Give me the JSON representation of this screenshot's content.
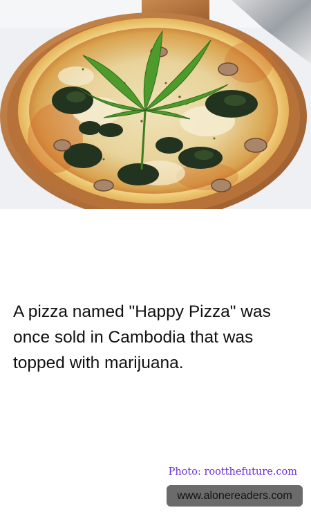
{
  "fact": {
    "text": "A pizza named \"Happy Pizza\" was once sold in Cambodia that was topped with marijuana."
  },
  "credit": {
    "text": "Photo: rootthefuture.com"
  },
  "watermark": {
    "text": "www.alonereaders.com"
  },
  "colors": {
    "credit": "#6a2fd8",
    "watermark_background": "#6b6b6b",
    "text": "#111111"
  }
}
